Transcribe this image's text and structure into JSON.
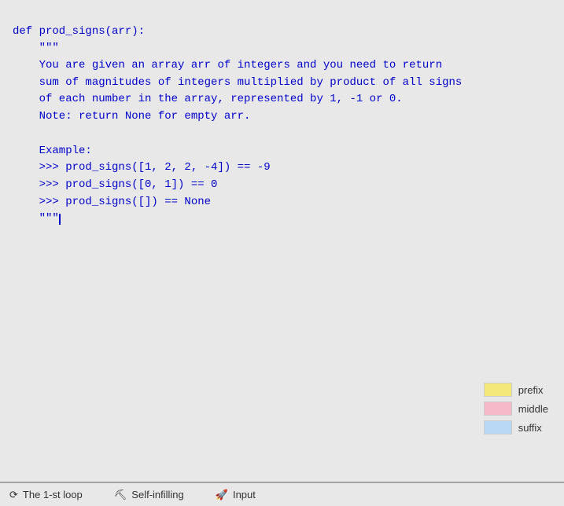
{
  "code": {
    "line1": "def prod_signs(arr):",
    "line2": "    \"\"\"",
    "line3": "    You are given an array arr of integers and you need to return",
    "line4": "    sum of magnitudes of integers multiplied by product of all signs",
    "line5": "    of each number in the array, represented by 1, -1 or 0.",
    "line6": "    Note: return None for empty arr.",
    "line7": "",
    "line8": "    Example:",
    "line9": "    >>> prod_signs([1, 2, 2, -4]) == -9",
    "line10": "    >>> prod_signs([0, 1]) == 0",
    "line11": "    >>> prod_signs([]) == None",
    "line12": "    \"\"\""
  },
  "legend": {
    "prefix_label": "prefix",
    "middle_label": "middle",
    "suffix_label": "suffix"
  },
  "status_bar": {
    "loop_icon": "⟳",
    "loop_label": "The 1-st loop",
    "self_infilling_icon": "⛏",
    "self_infilling_label": "Self-infilling",
    "input_icon": "🚀",
    "input_label": "Input"
  }
}
